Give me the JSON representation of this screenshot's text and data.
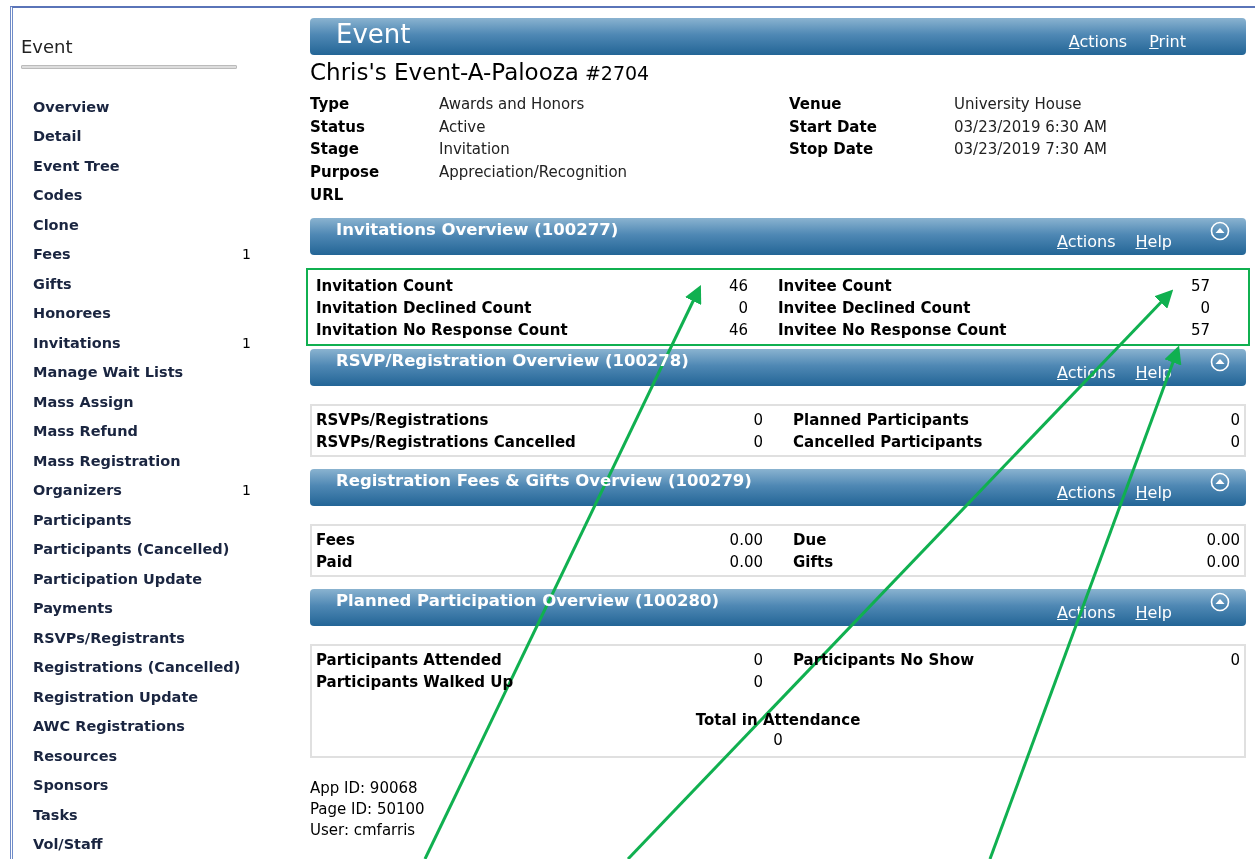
{
  "sidebar": {
    "title": "Event",
    "items": [
      {
        "label": "Overview"
      },
      {
        "label": "Detail"
      },
      {
        "label": "Event Tree"
      },
      {
        "label": "Codes"
      },
      {
        "label": "Clone"
      },
      {
        "label": "Fees",
        "count": "1"
      },
      {
        "label": "Gifts"
      },
      {
        "label": "Honorees"
      },
      {
        "label": "Invitations",
        "count": "1"
      },
      {
        "label": "Manage Wait Lists"
      },
      {
        "label": "Mass Assign"
      },
      {
        "label": "Mass Refund"
      },
      {
        "label": "Mass Registration"
      },
      {
        "label": "Organizers",
        "count": "1"
      },
      {
        "label": "Participants"
      },
      {
        "label": "Participants (Cancelled)"
      },
      {
        "label": "Participation Update"
      },
      {
        "label": "Payments"
      },
      {
        "label": "RSVPs/Registrants"
      },
      {
        "label": "Registrations (Cancelled)"
      },
      {
        "label": "Registration Update"
      },
      {
        "label": "AWC Registrations"
      },
      {
        "label": "Resources"
      },
      {
        "label": "Sponsors"
      },
      {
        "label": "Tasks"
      },
      {
        "label": "Vol/Staff"
      }
    ]
  },
  "header": {
    "title": "Event",
    "links": [
      "Actions",
      "Print"
    ]
  },
  "event": {
    "name": "Chris's Event-A-Palooza",
    "number": "#2704",
    "fields_left": [
      {
        "label": "Type",
        "value": "Awards and Honors"
      },
      {
        "label": "Status",
        "value": "Active"
      },
      {
        "label": "Stage",
        "value": "Invitation"
      },
      {
        "label": "Purpose",
        "value": "Appreciation/Recognition"
      },
      {
        "label": "URL"
      }
    ],
    "fields_right": [
      {
        "label": "Venue",
        "value": "University House"
      },
      {
        "label": "Start Date",
        "value": "03/23/2019 6:30 AM"
      },
      {
        "label": "Stop Date",
        "value": "03/23/2019 7:30 AM"
      }
    ]
  },
  "sections": [
    {
      "title": "Invitations Overview (100277)",
      "links": [
        "Actions",
        "Help"
      ],
      "highlighted": true,
      "rows": [
        [
          {
            "label": "Invitation Count",
            "value": "46"
          },
          {
            "label": "Invitee Count",
            "value": "57"
          }
        ],
        [
          {
            "label": "Invitation Declined Count",
            "value": "0"
          },
          {
            "label": "Invitee Declined Count",
            "value": "0"
          }
        ],
        [
          {
            "label": "Invitation No Response Count",
            "value": "46"
          },
          {
            "label": "Invitee No Response Count",
            "value": "57"
          }
        ]
      ]
    },
    {
      "title": "RSVP/Registration Overview (100278)",
      "links": [
        "Actions",
        "Help"
      ],
      "highlighted": false,
      "rows": [
        [
          {
            "label": "RSVPs/Registrations",
            "value": "0"
          },
          {
            "label": "Planned Participants",
            "value": "0"
          }
        ],
        [
          {
            "label": "RSVPs/Registrations Cancelled",
            "value": "0"
          },
          {
            "label": "Cancelled Participants",
            "value": "0"
          }
        ]
      ]
    },
    {
      "title": "Registration Fees & Gifts Overview (100279)",
      "links": [
        "Actions",
        "Help"
      ],
      "highlighted": false,
      "rows": [
        [
          {
            "label": "Fees",
            "value": "0.00"
          },
          {
            "label": "Due",
            "value": "0.00"
          }
        ],
        [
          {
            "label": "Paid",
            "value": "0.00"
          },
          {
            "label": "Gifts",
            "value": "0.00"
          }
        ]
      ]
    },
    {
      "title": "Planned Participation Overview (100280)",
      "links": [
        "Actions",
        "Help"
      ],
      "highlighted": false,
      "rows": [
        [
          {
            "label": "Participants Attended",
            "value": "0"
          },
          {
            "label": "Participants No Show",
            "value": "0"
          }
        ],
        [
          {
            "label": "Participants Walked Up",
            "value": "0"
          }
        ]
      ],
      "total": {
        "label": "Total in Attendance",
        "value": "0"
      }
    }
  ],
  "footer": [
    "App ID: 90068",
    "Page ID: 50100",
    "User: cmfarris"
  ]
}
